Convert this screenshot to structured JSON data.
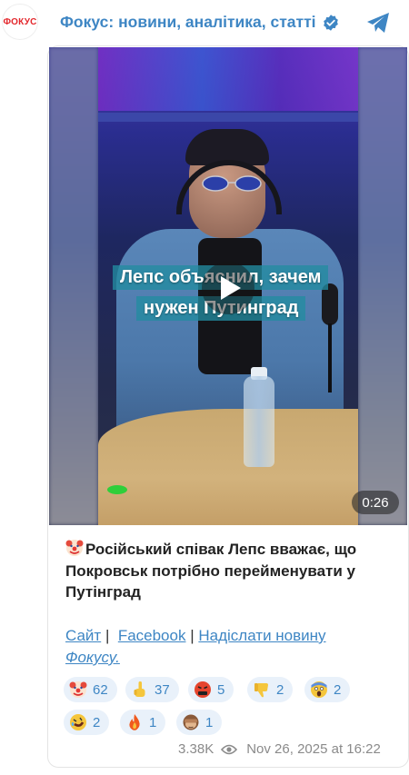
{
  "channel": {
    "avatar_text": "ФОКУС",
    "title": "Фокус: новини, аналітика, статті",
    "verified_icon": "verified-badge-icon",
    "share_icon": "telegram-icon"
  },
  "video": {
    "caption_line1": "Лепс объяснил, зачем",
    "caption_line2": "нужен Путинград",
    "duration": "0:26",
    "play_icon": "play-icon"
  },
  "post": {
    "emoji": "clown-face-emoji",
    "text": "Російський співак Лепс вважає, що Покровськ потрібно перейменувати у Путінград"
  },
  "links": {
    "site": "Сайт",
    "facebook": "Facebook",
    "send_news": "Надіслати новину",
    "fokus": "Фокусу."
  },
  "reactions": [
    {
      "emoji": "clown-face-emoji",
      "count": "62"
    },
    {
      "emoji": "middle-finger-emoji",
      "count": "37"
    },
    {
      "emoji": "cursing-face-emoji",
      "count": "5"
    },
    {
      "emoji": "thumbs-down-emoji",
      "count": "2"
    },
    {
      "emoji": "screaming-face-emoji",
      "count": "2"
    },
    {
      "emoji": "rofl-emoji",
      "count": "2"
    },
    {
      "emoji": "fire-emoji",
      "count": "1"
    },
    {
      "emoji": "see-no-evil-monkey-emoji",
      "count": "1"
    }
  ],
  "footer": {
    "views": "3.38K",
    "views_icon": "eye-icon",
    "date": "Nov 26, 2025 at 16:22"
  },
  "colors": {
    "accent": "#3e86c4",
    "reaction_bg": "#e9f1fa",
    "brand_red": "#e3262b"
  }
}
